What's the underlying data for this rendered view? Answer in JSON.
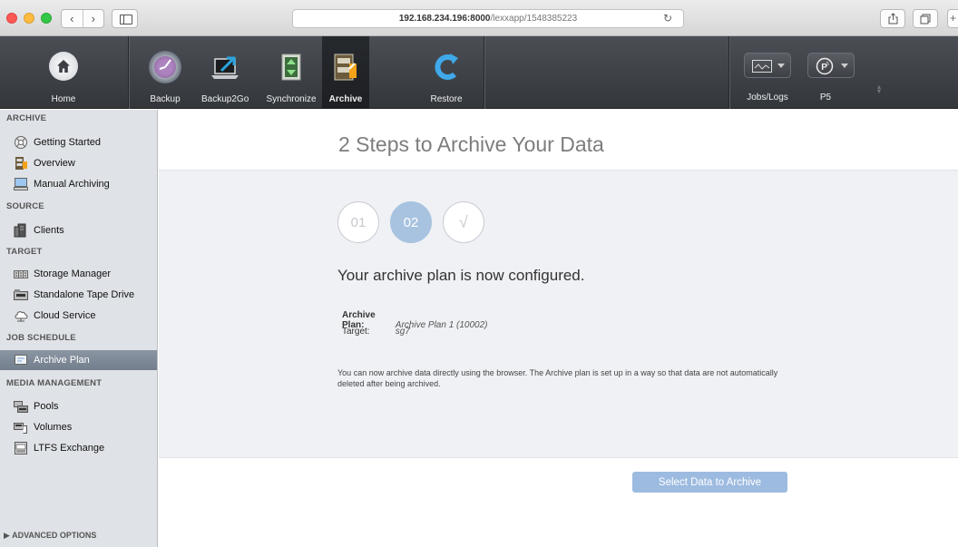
{
  "browser": {
    "url_host": "192.168.234.196",
    "url_port": ":8000",
    "url_path": "/lexxapp/1548385223"
  },
  "toolbar": {
    "home": "Home",
    "backup": "Backup",
    "backup2go": "Backup2Go",
    "synchronize": "Synchronize",
    "archive": "Archive",
    "restore": "Restore",
    "jobs_logs": "Jobs/Logs",
    "p5": "P5"
  },
  "sidebar": {
    "sections": {
      "archive": "ARCHIVE",
      "source": "SOURCE",
      "target": "TARGET",
      "job_schedule": "JOB SCHEDULE",
      "media_management": "MEDIA MANAGEMENT"
    },
    "items": {
      "getting_started": "Getting Started",
      "overview": "Overview",
      "manual_archiving": "Manual Archiving",
      "clients": "Clients",
      "storage_manager": "Storage Manager",
      "standalone_tape_drive": "Standalone Tape Drive",
      "cloud_service": "Cloud Service",
      "archive_plan": "Archive Plan",
      "pools": "Pools",
      "volumes": "Volumes",
      "ltfs_exchange": "LTFS Exchange"
    },
    "selected": "archive_plan",
    "advanced": "ADVANCED OPTIONS"
  },
  "main": {
    "title": "2 Steps to Archive Your Data",
    "steps": [
      "01",
      "02",
      "√"
    ],
    "current_step": 2,
    "confirm": "Your archive plan is now configured.",
    "archive_plan_label": "Archive Plan:",
    "archive_plan_value": "Archive Plan 1 (10002)",
    "target_label": "Target:",
    "target_value": "sg7",
    "note": "You can now archive data directly using the browser. The Archive plan is set up in a way so that data are not automatically deleted after being archived.",
    "select_button": "Select Data to Archive"
  },
  "colors": {
    "accent": "#a8c3e0",
    "button": "#9dbbe0",
    "toolbar": "#3d4146",
    "sidebar": "#dfe2e6",
    "selected_row": "#7f8a97"
  }
}
